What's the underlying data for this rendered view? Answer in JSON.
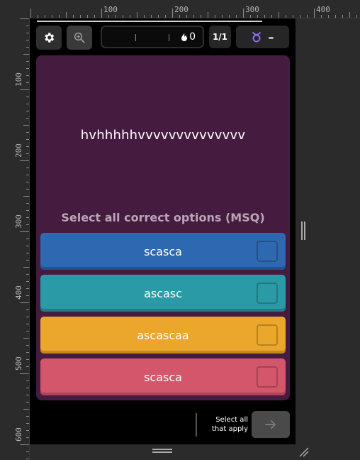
{
  "rulers": {
    "top_labels": [
      "100",
      "200",
      "300",
      "400"
    ],
    "left_labels": [
      "100",
      "200",
      "300",
      "400",
      "500",
      "600"
    ]
  },
  "toolbar": {
    "settings_icon": "gear-icon",
    "zoom_icon": "zoom-in-icon",
    "timer_value": "0",
    "timer_icon": "flame-icon",
    "question_counter": "1/1",
    "powerup_icon": "astro-powerup-icon",
    "powerup_value": "–"
  },
  "question": {
    "text": "hvhhhhhvvvvvvvvvvvvvv",
    "instruction": "Select all correct options (MSQ)"
  },
  "options": [
    {
      "label": "scasca",
      "color": "#2e68b0"
    },
    {
      "label": "ascasc",
      "color": "#2a9ba6"
    },
    {
      "label": "ascascaa",
      "color": "#eba72b"
    },
    {
      "label": "scasca",
      "color": "#d4566b"
    }
  ],
  "footer": {
    "hint_line1": "Select all",
    "hint_line2": "that apply",
    "next_icon": "arrow-right-icon"
  },
  "colors": {
    "card_background": "#461b40",
    "device_background": "#000000"
  }
}
